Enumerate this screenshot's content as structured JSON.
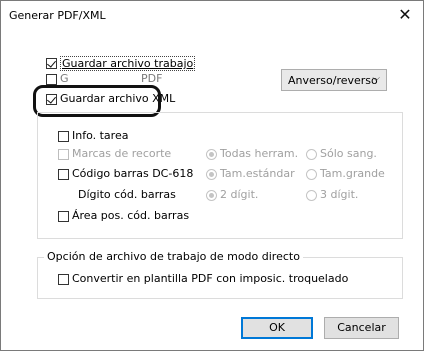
{
  "window": {
    "title": "Generar PDF/XML",
    "close_glyph": "✕"
  },
  "options": {
    "save_work_file": {
      "label": "Guardar archivo trabajo",
      "checked": true
    },
    "save_pdf_partial_a": "G",
    "save_pdf_partial_b": "PDF",
    "save_xml": {
      "label": "Guardar archivo XML",
      "checked": true
    }
  },
  "dropdown": {
    "value": "Anverso/reverso",
    "chevron": "⌵"
  },
  "group1": {
    "info_tarea": "Info. tarea",
    "marcas_recorte": "Marcas de recorte",
    "todas_herram": "Todas herram.",
    "solo_sang": "Sólo sang.",
    "codigo_barras": "Código barras DC-618",
    "tam_estandar": "Tam.estándar",
    "tam_grande": "Tam.grande",
    "digito_cod_barras": "Dígito cód. barras",
    "dos_digit": "2 dígit.",
    "tres_digit": "3 dígit.",
    "area_pos": "Área pos. cód. barras"
  },
  "group2": {
    "caption": "Opción de archivo de trabajo de modo directo",
    "convert_template": "Convertir en plantilla PDF con imposic. troquelado"
  },
  "buttons": {
    "ok": "OK",
    "cancel": "Cancelar"
  }
}
